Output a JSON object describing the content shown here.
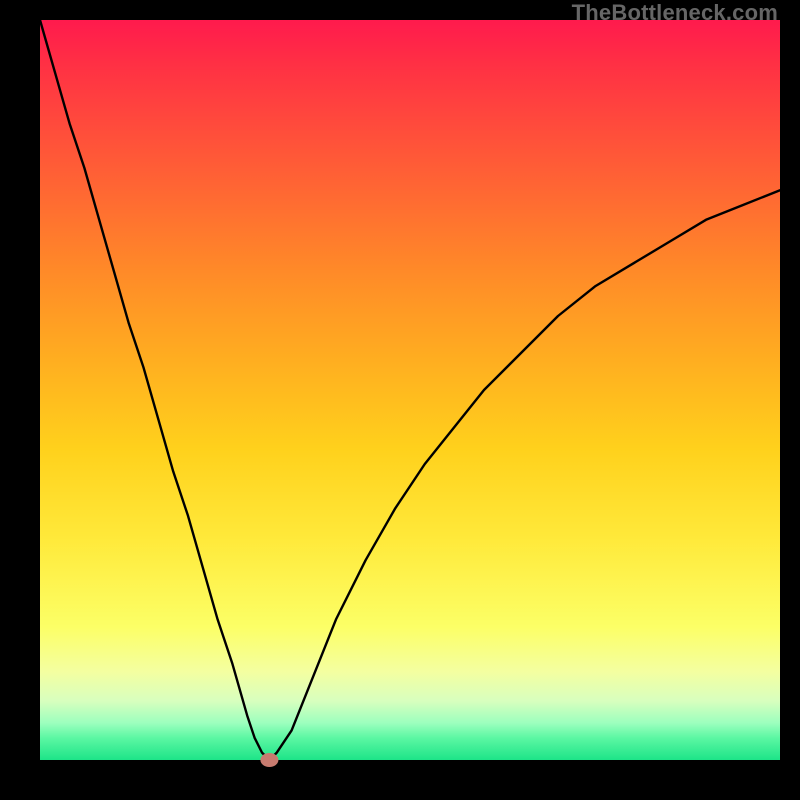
{
  "watermark": "TheBottleneck.com",
  "colors": {
    "marker": "#c77b6f",
    "curve": "#000000"
  },
  "chart_data": {
    "type": "line",
    "title": "",
    "xlabel": "",
    "ylabel": "",
    "xlim": [
      0,
      100
    ],
    "ylim": [
      0,
      100
    ],
    "series": [
      {
        "name": "bottleneck-curve",
        "x": [
          0,
          2,
          4,
          6,
          8,
          10,
          12,
          14,
          16,
          18,
          20,
          22,
          24,
          26,
          28,
          29,
          30,
          31,
          32,
          34,
          36,
          38,
          40,
          44,
          48,
          52,
          56,
          60,
          65,
          70,
          75,
          80,
          85,
          90,
          95,
          100
        ],
        "y": [
          100,
          93,
          86,
          80,
          73,
          66,
          59,
          53,
          46,
          39,
          33,
          26,
          19,
          13,
          6,
          3,
          1,
          0,
          1,
          4,
          9,
          14,
          19,
          27,
          34,
          40,
          45,
          50,
          55,
          60,
          64,
          67,
          70,
          73,
          75,
          77
        ]
      }
    ],
    "marker": {
      "x": 31,
      "y": 0
    },
    "grid": false,
    "legend": false
  }
}
